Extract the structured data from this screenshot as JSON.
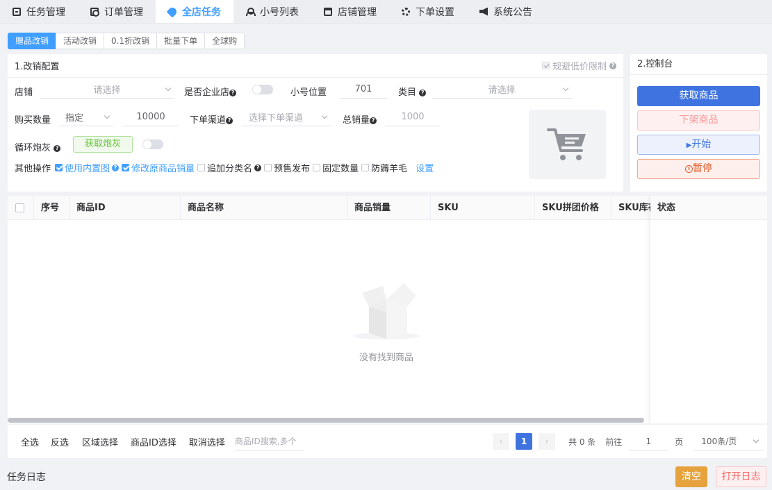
{
  "top_tabs": [
    {
      "label": "任务管理",
      "icon": "clipboard-icon"
    },
    {
      "label": "订单管理",
      "icon": "order-icon"
    },
    {
      "label": "全店任务",
      "icon": "tag-icon",
      "active": true
    },
    {
      "label": "小号列表",
      "icon": "users-icon"
    },
    {
      "label": "店铺管理",
      "icon": "shop-icon"
    },
    {
      "label": "下单设置",
      "icon": "gear-icon"
    },
    {
      "label": "系统公告",
      "icon": "speaker-icon"
    }
  ],
  "sub_tabs": [
    "赠品改销",
    "活动改销",
    "0.1折改销",
    "批量下单",
    "全球购"
  ],
  "config": {
    "title": "1.改销配置",
    "avoid_low_price": "规避低价限制",
    "shop_label": "店铺",
    "shop_placeholder": "请选择",
    "enterprise_label": "是否企业店",
    "account_position_label": "小号位置",
    "account_position_value": "701",
    "category_label": "类目",
    "category_placeholder": "请选择",
    "buy_qty_label": "购买数量",
    "buy_qty_mode": "指定",
    "buy_qty_value": "10000",
    "channel_label": "下单渠道",
    "channel_placeholder": "选择下单渠道",
    "total_sales_label": "总销量",
    "total_sales_placeholder": "1000",
    "loop_label": "循环炮灰",
    "get_cannon_button": "获取炮灰",
    "other_ops_label": "其他操作",
    "options": [
      {
        "label": "使用内置图",
        "checked": true,
        "help": true
      },
      {
        "label": "修改原商品销量",
        "checked": true,
        "help": false
      },
      {
        "label": "追加分类名",
        "checked": false,
        "help": true
      },
      {
        "label": "预售发布",
        "checked": false,
        "help": false
      },
      {
        "label": "固定数量",
        "checked": false,
        "help": false
      },
      {
        "label": "防薅羊毛",
        "checked": false,
        "help": false
      }
    ],
    "settings_link": "设置"
  },
  "control": {
    "title": "2.控制台",
    "get_goods": "获取商品",
    "delist_goods": "下架商品",
    "start": "开始",
    "pause": "暂停"
  },
  "table": {
    "columns": [
      "序号",
      "商品ID",
      "商品名称",
      "商品销量",
      "SKU",
      "SKU拼团价格",
      "SKU库存"
    ],
    "fixed_column": "状态",
    "empty_text": "没有找到商品"
  },
  "footer": {
    "select_all": "全选",
    "invert": "反选",
    "range_select": "区域选择",
    "id_select": "商品ID选择",
    "cancel_select": "取消选择",
    "search_placeholder": "商品ID搜索,多个",
    "current_page": "1",
    "total": "共 0 条",
    "goto": "前往",
    "goto_page": "1",
    "page_unit": "页",
    "page_size": "100条/页"
  },
  "log": {
    "title": "任务日志",
    "clear": "清空",
    "open": "打开日志"
  },
  "colors": {
    "primary": "#3f74e0",
    "accent": "#409eff",
    "warning": "#e6a23c",
    "danger": "#f56c6c",
    "success": "#67c23a"
  }
}
